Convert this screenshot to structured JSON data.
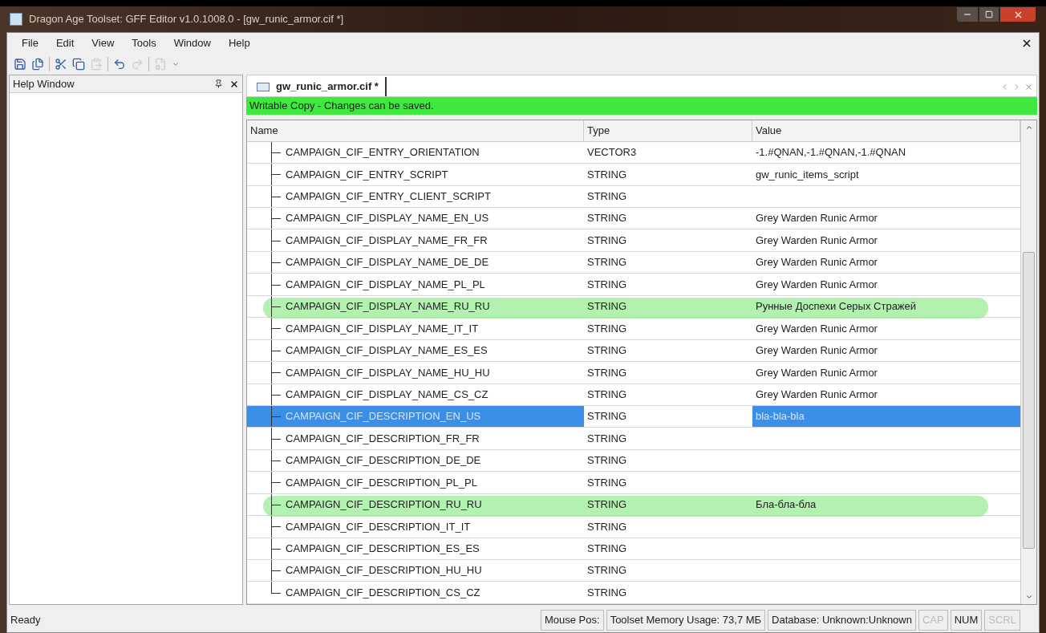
{
  "window": {
    "title": "Dragon Age Toolset: GFF Editor v1.0.1008.0 - [gw_runic_armor.cif *]"
  },
  "menu": [
    "File",
    "Edit",
    "View",
    "Tools",
    "Window",
    "Help"
  ],
  "toolbar": [
    [
      {
        "kind": "save",
        "disabled": false
      },
      {
        "kind": "save-all",
        "disabled": false
      }
    ],
    [
      {
        "kind": "cut",
        "disabled": false
      },
      {
        "kind": "copy",
        "disabled": false
      },
      {
        "kind": "paste",
        "disabled": true
      }
    ],
    [
      {
        "kind": "undo",
        "disabled": false
      },
      {
        "kind": "redo",
        "disabled": true
      }
    ],
    [
      {
        "kind": "properties",
        "disabled": true
      },
      {
        "kind": "dropdown",
        "disabled": false
      }
    ]
  ],
  "help_panel": {
    "title": "Help Window"
  },
  "document_tab": {
    "label": "gw_runic_armor.cif *",
    "selected": true
  },
  "banner": "Writable Copy - Changes can be saved.",
  "table": {
    "columns": [
      "Name",
      "Type",
      "Value"
    ],
    "rows": [
      {
        "name": "CAMPAIGN_CIF_ENTRY_ORIENTATION",
        "type": "VECTOR3",
        "value": "-1.#QNAN,-1.#QNAN,-1.#QNAN",
        "selected": false,
        "highlighted": false
      },
      {
        "name": "CAMPAIGN_CIF_ENTRY_SCRIPT",
        "type": "STRING",
        "value": "gw_runic_items_script",
        "selected": false,
        "highlighted": false
      },
      {
        "name": "CAMPAIGN_CIF_ENTRY_CLIENT_SCRIPT",
        "type": "STRING",
        "value": "",
        "selected": false,
        "highlighted": false
      },
      {
        "name": "CAMPAIGN_CIF_DISPLAY_NAME_EN_US",
        "type": "STRING",
        "value": "Grey Warden Runic Armor",
        "selected": false,
        "highlighted": false
      },
      {
        "name": "CAMPAIGN_CIF_DISPLAY_NAME_FR_FR",
        "type": "STRING",
        "value": "Grey Warden Runic Armor",
        "selected": false,
        "highlighted": false
      },
      {
        "name": "CAMPAIGN_CIF_DISPLAY_NAME_DE_DE",
        "type": "STRING",
        "value": "Grey Warden Runic Armor",
        "selected": false,
        "highlighted": false
      },
      {
        "name": "CAMPAIGN_CIF_DISPLAY_NAME_PL_PL",
        "type": "STRING",
        "value": "Grey Warden Runic Armor",
        "selected": false,
        "highlighted": false
      },
      {
        "name": "CAMPAIGN_CIF_DISPLAY_NAME_RU_RU",
        "type": "STRING",
        "value": "Рунные Доспехи Серых Стражей",
        "selected": false,
        "highlighted": true
      },
      {
        "name": "CAMPAIGN_CIF_DISPLAY_NAME_IT_IT",
        "type": "STRING",
        "value": "Grey Warden Runic Armor",
        "selected": false,
        "highlighted": false
      },
      {
        "name": "CAMPAIGN_CIF_DISPLAY_NAME_ES_ES",
        "type": "STRING",
        "value": "Grey Warden Runic Armor",
        "selected": false,
        "highlighted": false
      },
      {
        "name": "CAMPAIGN_CIF_DISPLAY_NAME_HU_HU",
        "type": "STRING",
        "value": "Grey Warden Runic Armor",
        "selected": false,
        "highlighted": false
      },
      {
        "name": "CAMPAIGN_CIF_DISPLAY_NAME_CS_CZ",
        "type": "STRING",
        "value": "Grey Warden Runic Armor",
        "selected": false,
        "highlighted": false
      },
      {
        "name": "CAMPAIGN_CIF_DESCRIPTION_EN_US",
        "type": "STRING",
        "value": "bla-bla-bla",
        "selected": true,
        "highlighted": false
      },
      {
        "name": "CAMPAIGN_CIF_DESCRIPTION_FR_FR",
        "type": "STRING",
        "value": "",
        "selected": false,
        "highlighted": false
      },
      {
        "name": "CAMPAIGN_CIF_DESCRIPTION_DE_DE",
        "type": "STRING",
        "value": "",
        "selected": false,
        "highlighted": false
      },
      {
        "name": "CAMPAIGN_CIF_DESCRIPTION_PL_PL",
        "type": "STRING",
        "value": "",
        "selected": false,
        "highlighted": false
      },
      {
        "name": "CAMPAIGN_CIF_DESCRIPTION_RU_RU",
        "type": "STRING",
        "value": "Бла-бла-бла",
        "selected": false,
        "highlighted": true
      },
      {
        "name": "CAMPAIGN_CIF_DESCRIPTION_IT_IT",
        "type": "STRING",
        "value": "",
        "selected": false,
        "highlighted": false
      },
      {
        "name": "CAMPAIGN_CIF_DESCRIPTION_ES_ES",
        "type": "STRING",
        "value": "",
        "selected": false,
        "highlighted": false
      },
      {
        "name": "CAMPAIGN_CIF_DESCRIPTION_HU_HU",
        "type": "STRING",
        "value": "",
        "selected": false,
        "highlighted": false
      },
      {
        "name": "CAMPAIGN_CIF_DESCRIPTION_CS_CZ",
        "type": "STRING",
        "value": "",
        "selected": false,
        "highlighted": false
      }
    ]
  },
  "status_bar": [
    {
      "text": "Ready",
      "disabled": false
    },
    {
      "text": "Mouse Pos:",
      "disabled": false
    },
    {
      "text": "Toolset Memory Usage: 73,7 МБ",
      "disabled": false
    },
    {
      "text": "Database: Unknown:Unknown",
      "disabled": false
    },
    {
      "text": "CAP",
      "disabled": true
    },
    {
      "text": "NUM",
      "disabled": false
    },
    {
      "text": "SCRL",
      "disabled": true
    }
  ]
}
